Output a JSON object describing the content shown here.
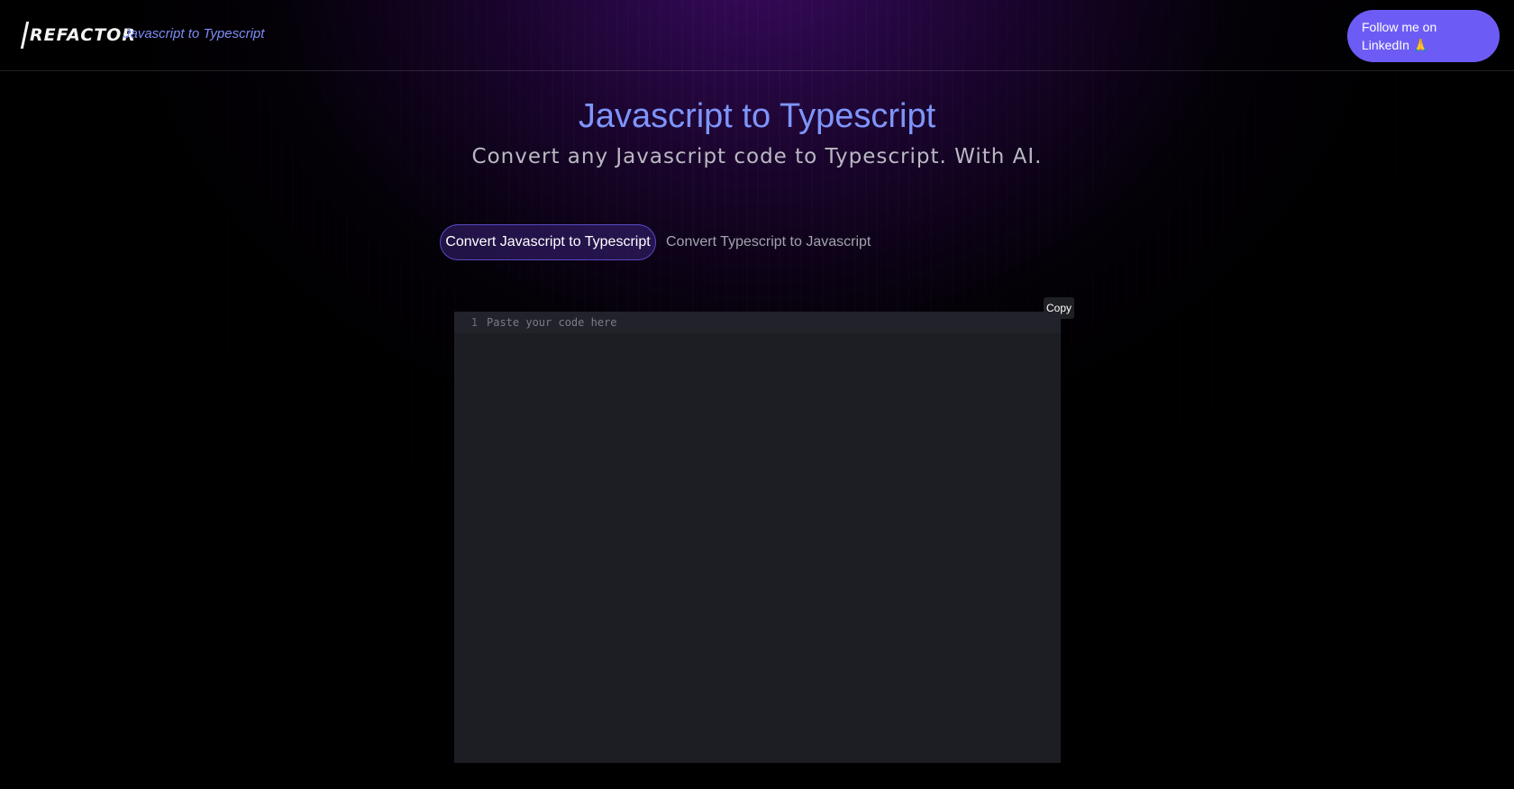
{
  "header": {
    "logo_text": "REFACTOR",
    "subtitle": "Javascript to Typescript",
    "follow_button": "Follow me on LinkedIn 🙏"
  },
  "hero": {
    "title": "Javascript to Typescript",
    "subtitle": "Convert any Javascript code to Typescript. With AI."
  },
  "tabs": [
    {
      "label": "Convert Javascript to Typescript",
      "active": true
    },
    {
      "label": "Convert Typescript to Javascript",
      "active": false
    }
  ],
  "editor": {
    "copy_label": "Copy",
    "line_number": "1",
    "placeholder": "Paste your code here",
    "value": ""
  },
  "colors": {
    "accent": "#6c5cf5",
    "title": "#7e95fb",
    "editor_bg": "#1d1e24"
  }
}
